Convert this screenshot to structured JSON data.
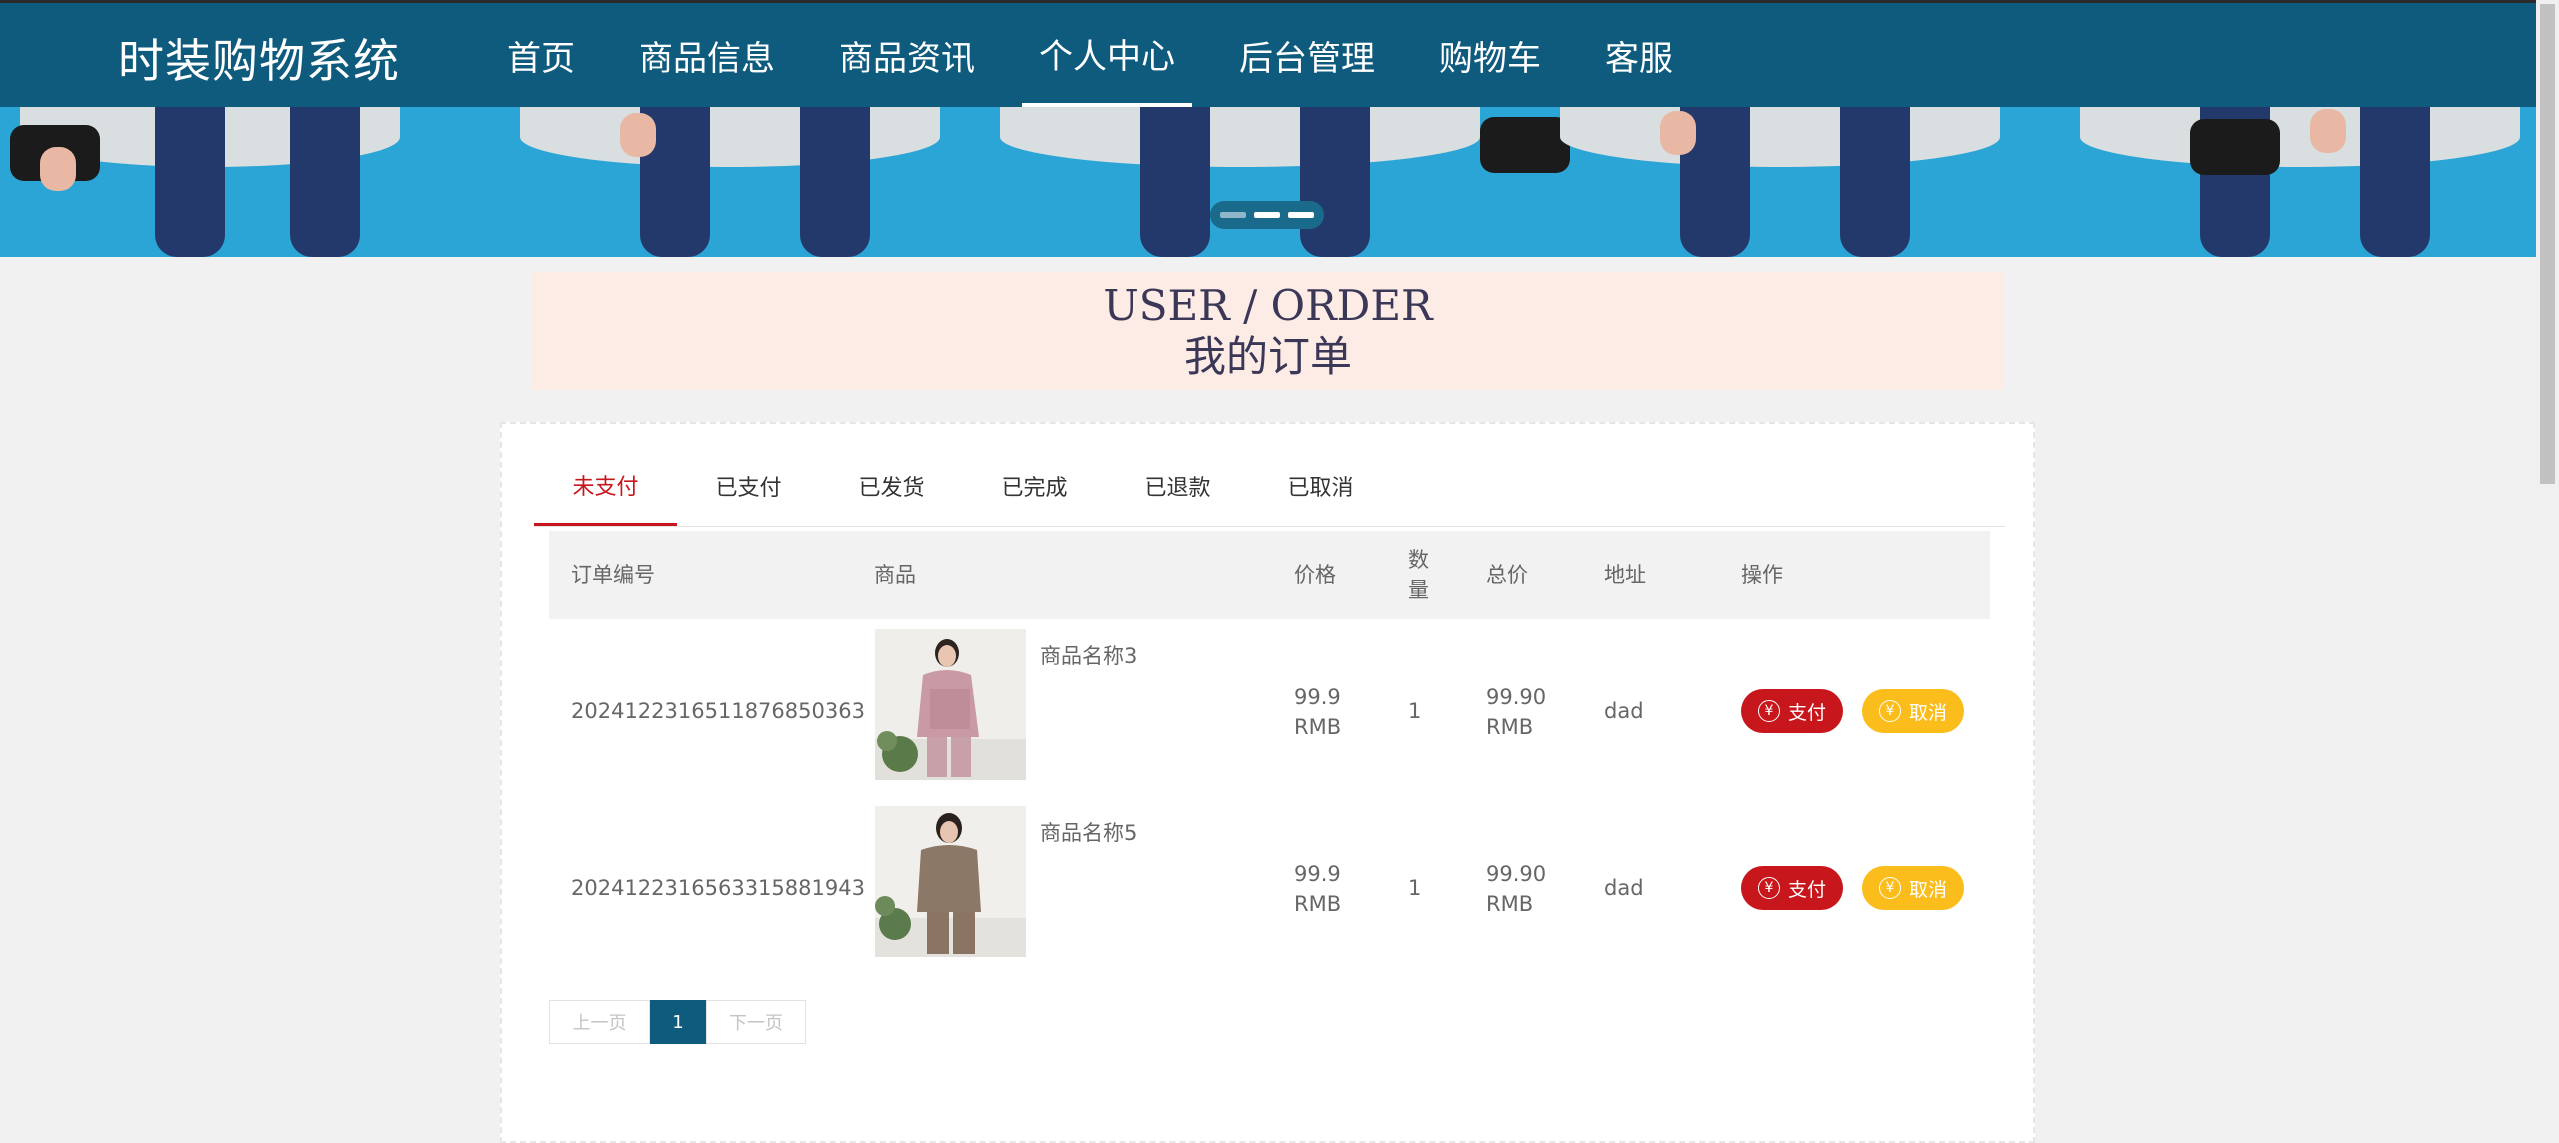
{
  "brand": "时装购物系统",
  "nav": [
    {
      "label": "首页"
    },
    {
      "label": "商品信息"
    },
    {
      "label": "商品资讯"
    },
    {
      "label": "个人中心",
      "active": true
    },
    {
      "label": "后台管理"
    },
    {
      "label": "购物车"
    },
    {
      "label": "客服"
    }
  ],
  "banner": {
    "slides": 3,
    "active_slide": 1
  },
  "heading": {
    "en": "USER / ORDER",
    "cn": "我的订单"
  },
  "tabs": [
    {
      "label": "未支付",
      "active": true
    },
    {
      "label": "已支付"
    },
    {
      "label": "已发货"
    },
    {
      "label": "已完成"
    },
    {
      "label": "已退款"
    },
    {
      "label": "已取消"
    }
  ],
  "table": {
    "headers": {
      "order_no": "订单编号",
      "product": "商品",
      "price": "价格",
      "qty": "数量",
      "total": "总价",
      "address": "地址",
      "action": "操作"
    },
    "rows": [
      {
        "order_no": "20241223165118768503 63",
        "product": "商品名称3",
        "price": "99.9",
        "price_unit": "RMB",
        "qty": "1",
        "total": "99.90",
        "total_unit": "RMB",
        "address": "dad",
        "pay": "支付",
        "cancel": "取消"
      },
      {
        "order_no": "202412231656331588194 3",
        "product": "商品名称5",
        "price": "99.9",
        "price_unit": "RMB",
        "qty": "1",
        "total": "99.90",
        "total_unit": "RMB",
        "address": "dad",
        "pay": "支付",
        "cancel": "取消"
      }
    ]
  },
  "pager": {
    "prev": "上一页",
    "current": "1",
    "next": "下一页"
  },
  "colors": {
    "nav_bg": "#0f5b7e",
    "accent_red": "#c8161d",
    "accent_yellow": "#fbbd1c",
    "heading_bg": "#fcece5"
  }
}
